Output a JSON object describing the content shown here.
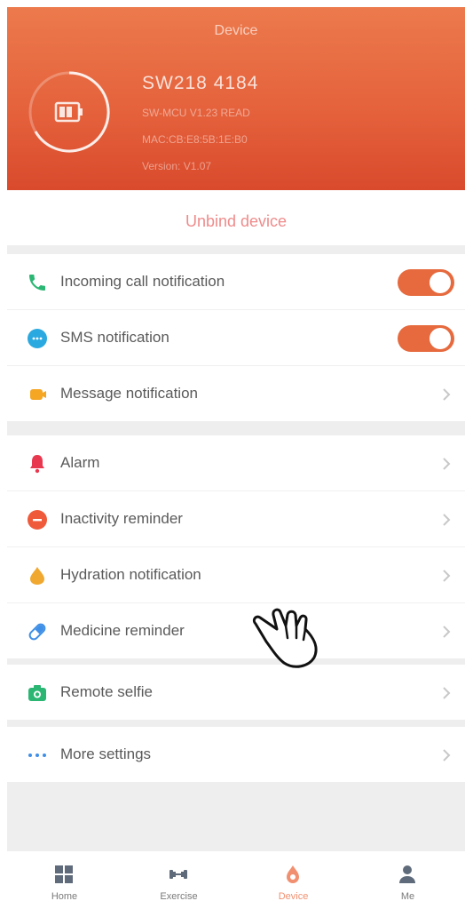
{
  "header": {
    "title": "Device",
    "device_name": "SW218 4184",
    "info_lines": [
      "SW-MCU V1.23 READ",
      "MAC:CB:E8:5B:1E:B0",
      "Version: V1.07"
    ]
  },
  "unbind": {
    "label": "Unbind device"
  },
  "group1": [
    {
      "label": "Incoming call notification",
      "icon": "phone-icon",
      "color": "#2bb673",
      "control": "toggle",
      "on": true
    },
    {
      "label": "SMS notification",
      "icon": "sms-icon",
      "color": "#2aa9e0",
      "control": "toggle",
      "on": true
    },
    {
      "label": "Message notification",
      "icon": "message-icon",
      "color": "#f5a623",
      "control": "chevron"
    }
  ],
  "group2": [
    {
      "label": "Alarm",
      "icon": "alarm-icon",
      "color": "#e8384f",
      "control": "chevron"
    },
    {
      "label": "Inactivity reminder",
      "icon": "inactivity-icon",
      "color": "#ef5a3a",
      "control": "chevron"
    },
    {
      "label": "Hydration notification",
      "icon": "water-drop-icon",
      "color": "#f0a830",
      "control": "chevron"
    },
    {
      "label": "Medicine reminder",
      "icon": "pill-icon",
      "color": "#3f8fe6",
      "control": "chevron"
    }
  ],
  "group3": [
    {
      "label": "Remote selfie",
      "icon": "camera-icon",
      "color": "#2bb673",
      "control": "chevron"
    }
  ],
  "group4": [
    {
      "label": "More settings",
      "icon": "more-dots-icon",
      "color": "#3f8fe6",
      "control": "chevron"
    }
  ],
  "tabs": [
    {
      "label": "Home",
      "icon": "home-grid-icon",
      "active": false
    },
    {
      "label": "Exercise",
      "icon": "dumbbell-icon",
      "active": false
    },
    {
      "label": "Device",
      "icon": "watch-icon",
      "active": true
    },
    {
      "label": "Me",
      "icon": "person-icon",
      "active": false
    }
  ],
  "colors": {
    "accent": "#e66a3e",
    "header_top": "#ec7a4c",
    "header_bottom": "#d94a2c",
    "unbind_text": "#ef8b8b"
  }
}
